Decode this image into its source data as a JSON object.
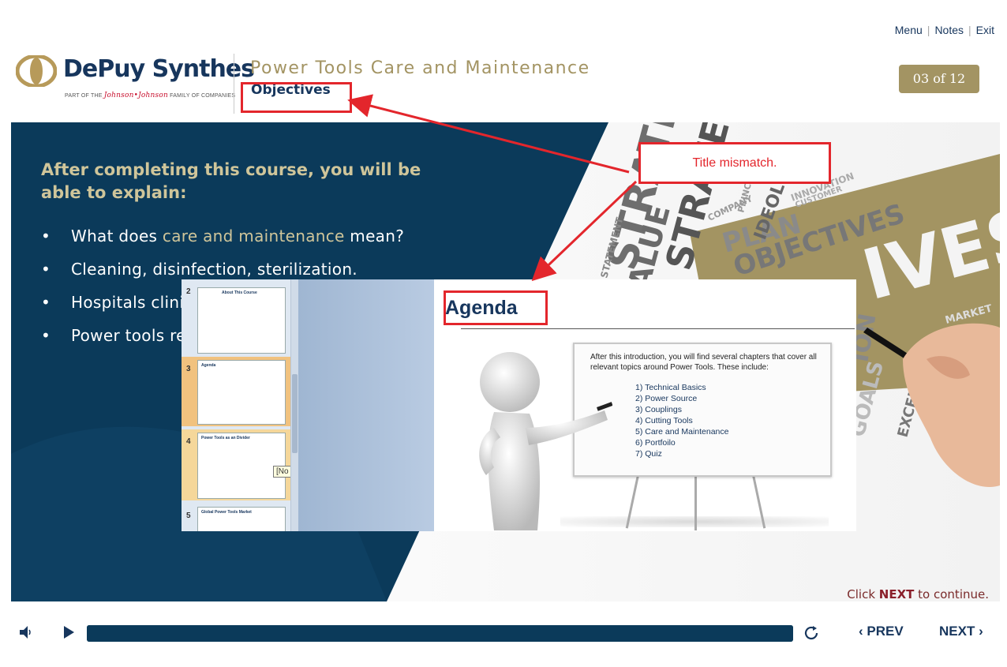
{
  "header": {
    "brand": "DePuy Synthes",
    "tagline_prefix": "PART OF THE",
    "tagline_jj": "Johnson•Johnson",
    "tagline_suffix": "FAMILY OF COMPANIES",
    "course_title": "Power Tools Care and Maintenance",
    "slide_title": "Objectives",
    "links": {
      "menu": "Menu",
      "notes": "Notes",
      "exit": "Exit"
    },
    "slide_counter": "03 of 12"
  },
  "slide": {
    "heading": "After completing this course, you will be able to explain:",
    "bullets": [
      {
        "before": "What does ",
        "accent": "care and maintenance",
        "after": " mean?"
      },
      {
        "before": "Cleaning, disinfection, sterilization.",
        "accent": "",
        "after": ""
      },
      {
        "before": "Hospitals clini",
        "accent": "",
        "after": ""
      },
      {
        "before": "Power tools re",
        "accent": "",
        "after": ""
      }
    ],
    "collage_words": [
      "STRATEGY",
      "VALUE",
      "PLAN",
      "PRINCIPLE",
      "IDEOLOGY",
      "INNOVATION",
      "OBJECTIVES",
      "COMPANY",
      "CUSTOMER",
      "STATEMENT",
      "IVES",
      "GOALS",
      "EXCELLENCE",
      "ION",
      "MARKET"
    ],
    "click_prefix": "Click ",
    "click_bold": "NEXT",
    "click_suffix": " to continue."
  },
  "overlay": {
    "thumbnails": [
      {
        "num": "2",
        "title": "About This Course"
      },
      {
        "num": "3",
        "title": "Agenda"
      },
      {
        "num": "4",
        "title": "Power Tools as an Divider"
      },
      {
        "num": "5",
        "title": "Global Power Tools Market"
      }
    ],
    "tooltip": "[No Title]",
    "agenda_title": "Agenda",
    "intro": "After this introduction, you will find several chapters that cover all relevant topics around Power Tools. These include:",
    "items": [
      "1) Technical Basics",
      "2) Power Source",
      "3) Couplings",
      "4) Cutting Tools",
      "5) Care and Maintenance",
      "6) Portfoilo",
      "7) Quiz"
    ]
  },
  "annotation": {
    "label": "Title mismatch.",
    "color": "#e3262c"
  },
  "player": {
    "prev_label": "PREV",
    "next_label": "NEXT",
    "progress_fraction": 1.0
  },
  "colors": {
    "navy": "#0b3a5a",
    "gold": "#a39463",
    "accent_text": "#cfc59a"
  }
}
